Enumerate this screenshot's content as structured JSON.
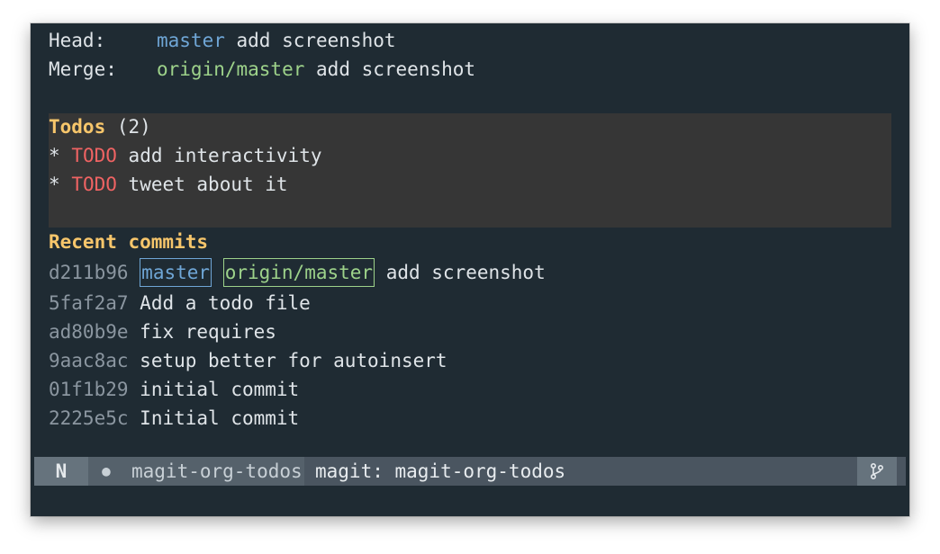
{
  "header": {
    "head_label": "Head:",
    "head_branch": "master",
    "head_message": "add screenshot",
    "merge_label": "Merge:",
    "merge_branch": "origin/master",
    "merge_message": "add screenshot"
  },
  "todos": {
    "title": "Todos",
    "count": "(2)",
    "items": [
      {
        "bullet": "*",
        "keyword": "TODO",
        "text": "add interactivity"
      },
      {
        "bullet": "*",
        "keyword": "TODO",
        "text": "tweet about it"
      }
    ]
  },
  "commits": {
    "title": "Recent commits",
    "items": [
      {
        "hash": "d211b96",
        "refs": [
          "master",
          "origin/master"
        ],
        "message": "add screenshot"
      },
      {
        "hash": "5faf2a7",
        "message": "Add a todo file"
      },
      {
        "hash": "ad80b9e",
        "message": "fix requires"
      },
      {
        "hash": "9aac8ac",
        "message": "setup better for autoinsert"
      },
      {
        "hash": "01f1b29",
        "message": "initial commit"
      },
      {
        "hash": "2225e5c",
        "message": "Initial commit"
      }
    ]
  },
  "modeline": {
    "state": "N",
    "modified_dot": "●",
    "project": "magit-org-todos",
    "buffer": "magit: magit-org-todos",
    "vc_icon": "git-branch-icon"
  },
  "colors": {
    "background": "#1f2b33",
    "section_heading": "#f7c66b",
    "todo_keyword": "#ef6363",
    "local_branch": "#6fa6d6",
    "remote_branch": "#9dd28a",
    "hash": "#8b96a0",
    "todo_block_bg": "#363636"
  }
}
